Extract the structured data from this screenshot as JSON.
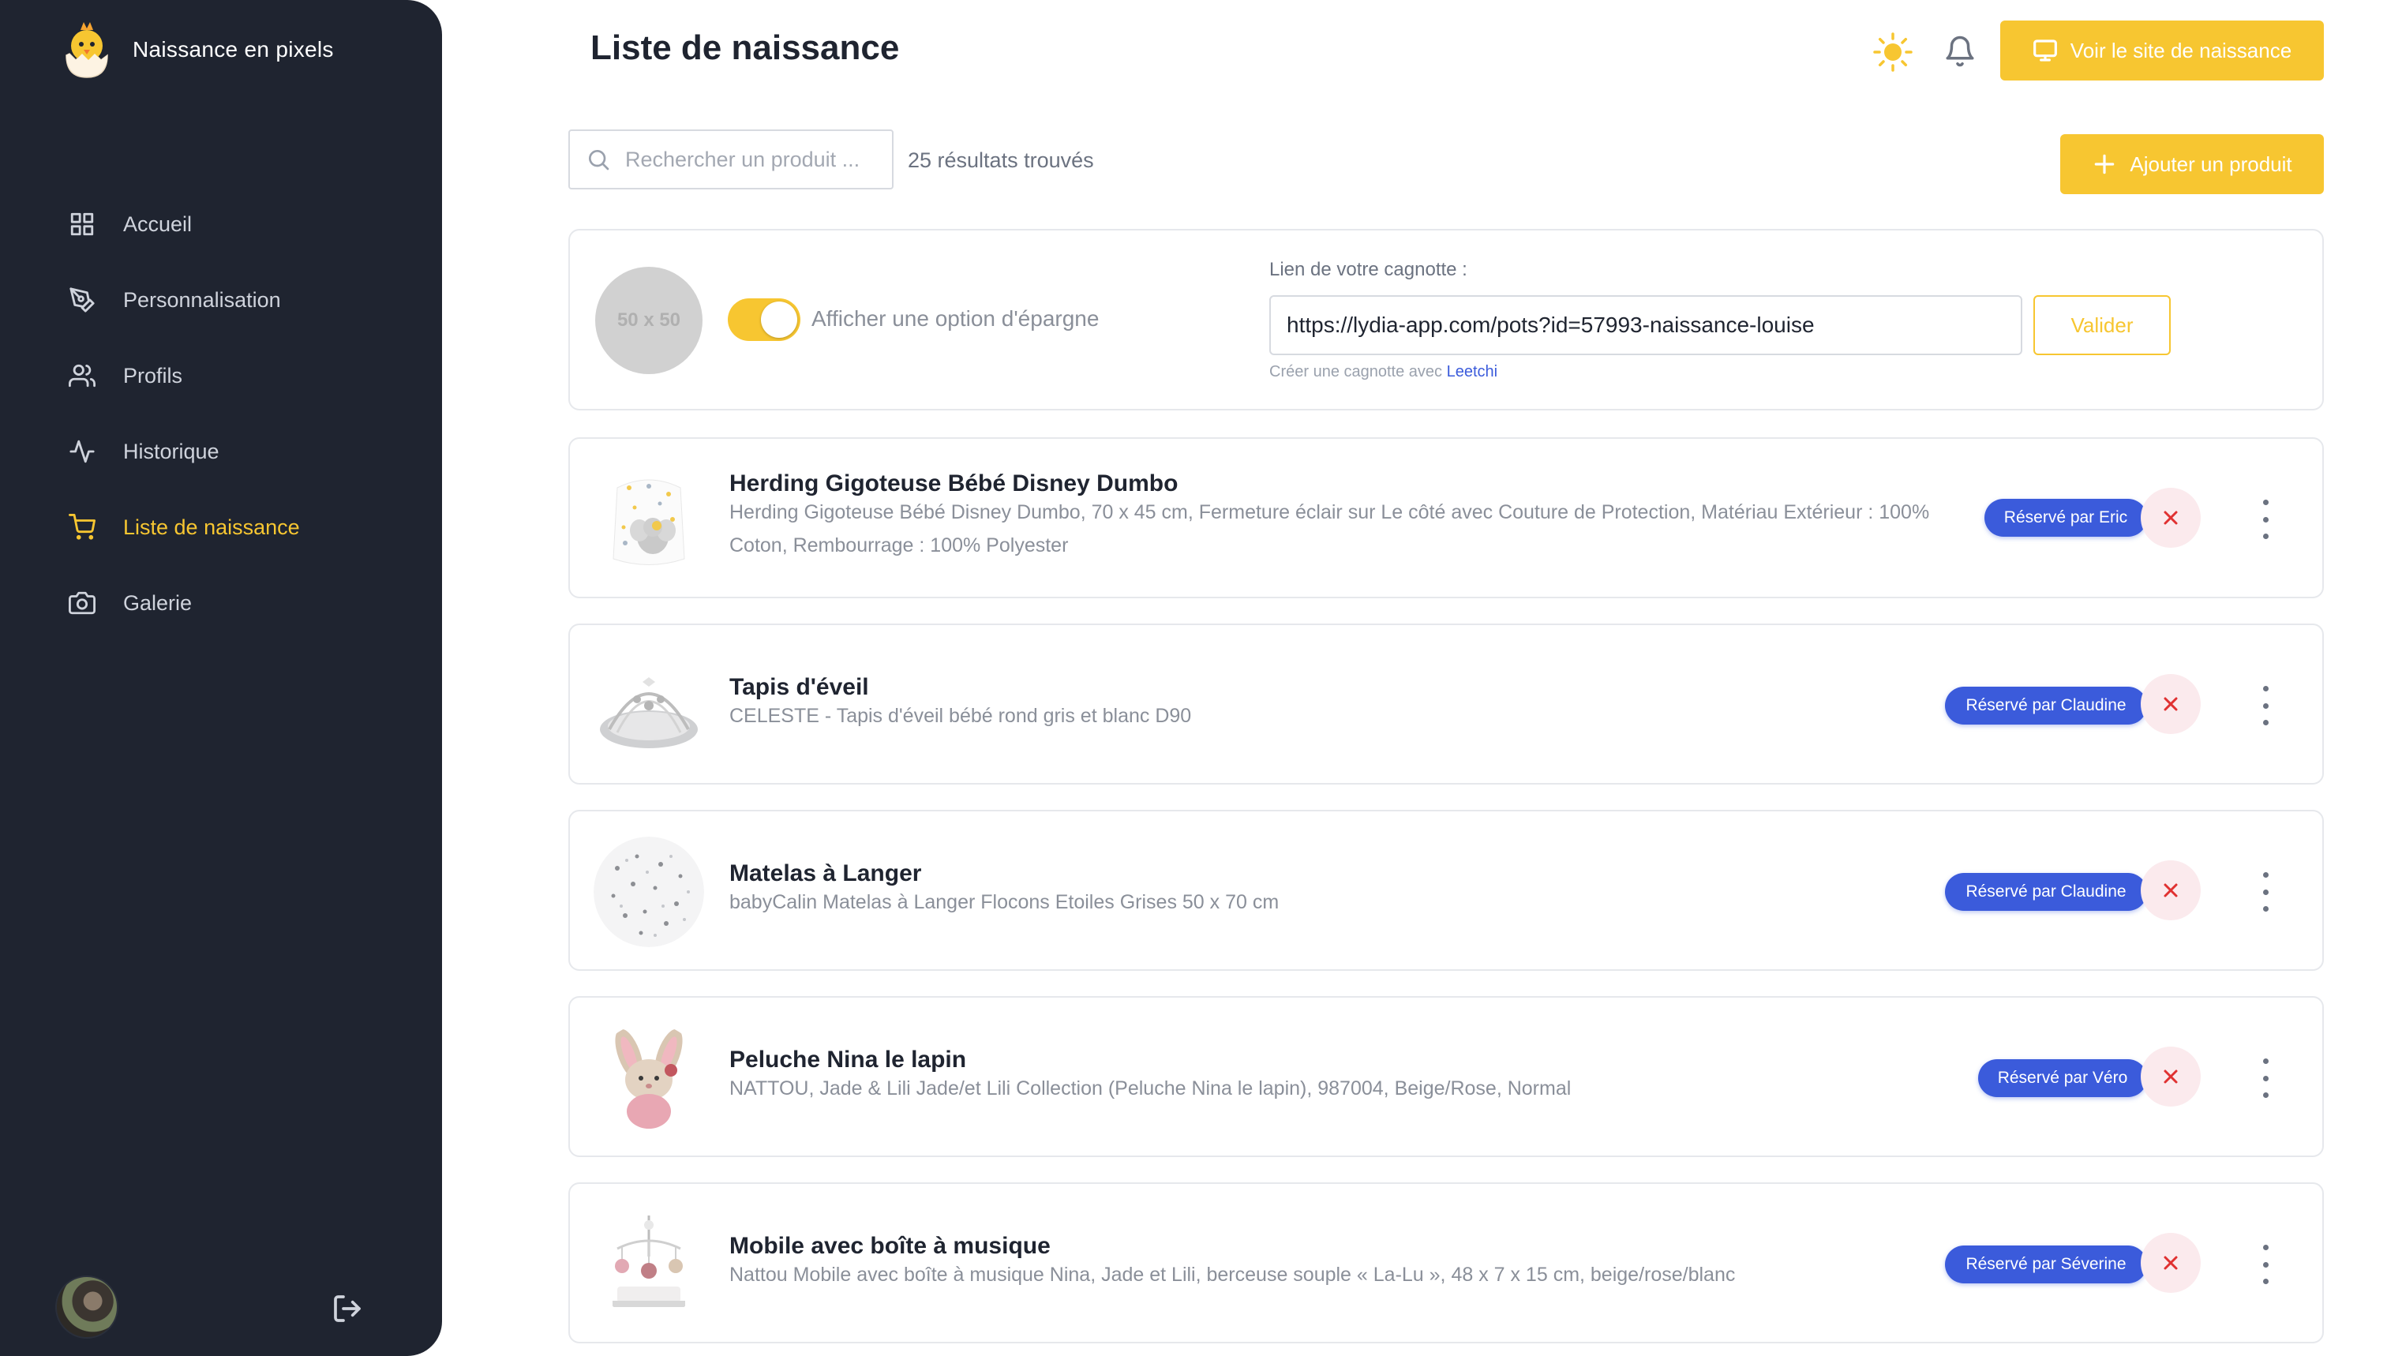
{
  "app": {
    "title": "Naissance en pixels"
  },
  "sidebar": {
    "items": [
      {
        "label": "Accueil",
        "icon": "grid-icon"
      },
      {
        "label": "Personnalisation",
        "icon": "pen-tool-icon"
      },
      {
        "label": "Profils",
        "icon": "users-icon"
      },
      {
        "label": "Historique",
        "icon": "activity-icon"
      },
      {
        "label": "Liste de naissance",
        "icon": "cart-icon",
        "active": true
      },
      {
        "label": "Galerie",
        "icon": "camera-icon"
      }
    ]
  },
  "header": {
    "title": "Liste de naissance",
    "site_button": "Voir le site de naissance"
  },
  "toolbar": {
    "search_placeholder": "Rechercher un produit ...",
    "results_text": "25 résultats trouvés",
    "add_button": "Ajouter un produit"
  },
  "savings": {
    "image_placeholder": "50 x 50",
    "toggle_label": "Afficher une option d'épargne",
    "toggle_on": true,
    "pot_label": "Lien de votre cagnotte :",
    "pot_url": "https://lydia-app.com/pots?id=57993-naissance-louise",
    "validate_button": "Valider",
    "hint_text": "Créer une cagnotte avec",
    "hint_link": "Leetchi"
  },
  "products": [
    {
      "title": "Herding Gigoteuse Bébé Disney Dumbo",
      "description": "Herding Gigoteuse Bébé Disney Dumbo, 70 x 45 cm, Fermeture éclair sur Le côté avec Couture de Protection, Matériau Extérieur : 100% Coton, Rembourrage : 100% Polyester",
      "reserved": "Réservé par Eric"
    },
    {
      "title": "Tapis d'éveil",
      "description": "CELESTE - Tapis d'éveil bébé rond gris et blanc D90",
      "reserved": "Réservé par Claudine"
    },
    {
      "title": "Matelas à Langer",
      "description": "babyCalin Matelas à Langer Flocons Etoiles Grises 50 x 70 cm",
      "reserved": "Réservé par Claudine"
    },
    {
      "title": "Peluche Nina le lapin",
      "description": "NATTOU, Jade & Lili Jade/et Lili Collection (Peluche Nina le lapin), 987004, Beige/Rose, Normal",
      "reserved": "Réservé par Véro"
    },
    {
      "title": "Mobile avec boîte à musique",
      "description": "Nattou Mobile avec boîte à musique Nina, Jade et Lili, berceuse souple « La-Lu », 48 x 7 x 15 cm, beige/rose/blanc",
      "reserved": "Réservé par Séverine"
    }
  ],
  "colors": {
    "sidebar_bg": "#1f2430",
    "accent_yellow": "#f7c631",
    "badge_blue": "#3b5bdb",
    "remove_red": "#e03131"
  }
}
